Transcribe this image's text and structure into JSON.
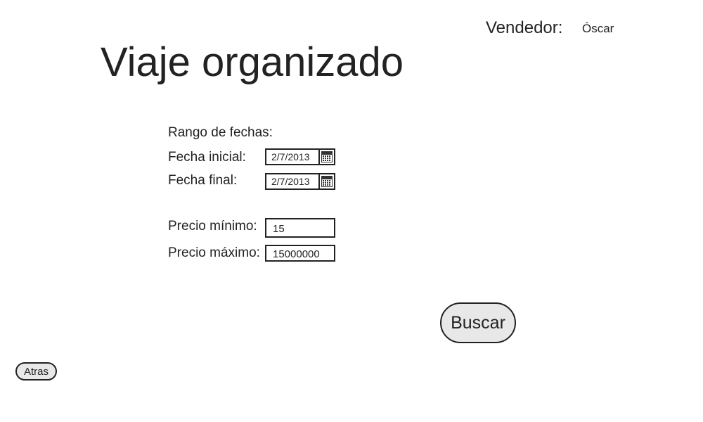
{
  "header": {
    "seller_label": "Vendedor:",
    "seller_name": "Óscar",
    "title": "Viaje organizado"
  },
  "form": {
    "date_range_label": "Rango de fechas:",
    "start_date_label": "Fecha inicial:",
    "start_date_value": "2/7/2013",
    "end_date_label": "Fecha final:",
    "end_date_value": "2/7/2013",
    "min_price_label": "Precio mínimo:",
    "min_price_value": "15",
    "max_price_label": "Precio máximo:",
    "max_price_value": "15000000"
  },
  "actions": {
    "search_label": "Buscar",
    "back_label": "Atras"
  },
  "icons": {
    "date_picker": "calendar-icon"
  }
}
